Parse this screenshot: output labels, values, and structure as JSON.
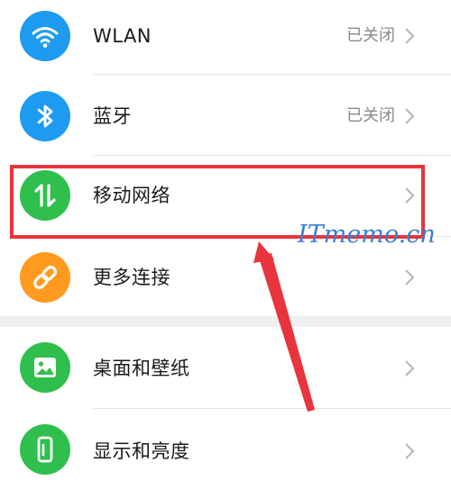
{
  "settings": {
    "items": [
      {
        "label": "WLAN",
        "status": "已关闭",
        "icon": "wifi-icon",
        "color": "#1e9bf0"
      },
      {
        "label": "蓝牙",
        "status": "已关闭",
        "icon": "bluetooth-icon",
        "color": "#1e9bf0"
      },
      {
        "label": "移动网络",
        "status": "",
        "icon": "mobile-data-icon",
        "color": "#2fbf4d"
      },
      {
        "label": "更多连接",
        "status": "",
        "icon": "link-icon",
        "color": "#ff9a1e"
      },
      {
        "label": "桌面和壁纸",
        "status": "",
        "icon": "wallpaper-icon",
        "color": "#2fbf4d"
      },
      {
        "label": "显示和亮度",
        "status": "",
        "icon": "display-icon",
        "color": "#2fbf4d"
      }
    ]
  },
  "annotation": {
    "watermark": "ITmemo.cn",
    "highlight_color": "#e8343c"
  }
}
